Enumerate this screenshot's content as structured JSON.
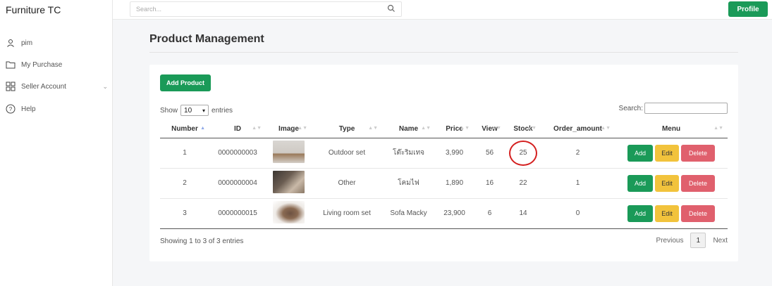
{
  "brand": "Furniture TC",
  "sidebar": {
    "items": [
      {
        "label": "pim",
        "icon": "user-icon"
      },
      {
        "label": "My Purchase",
        "icon": "folder-icon"
      },
      {
        "label": "Seller Account",
        "icon": "grid-icon"
      },
      {
        "label": "Help",
        "icon": "help-icon"
      }
    ]
  },
  "topbar": {
    "search_placeholder": "Search...",
    "profile_label": "Profile"
  },
  "page_title": "Product Management",
  "add_product_label": "Add Product",
  "show": {
    "prefix": "Show",
    "value": "10",
    "suffix": "entries"
  },
  "search_label": "Search:",
  "columns": [
    "Number",
    "ID",
    "Image",
    "Type",
    "Name",
    "Price",
    "View",
    "Stock",
    "Order_amount",
    "Menu"
  ],
  "rows": [
    {
      "number": "1",
      "id": "0000000003",
      "type": "Outdoor set",
      "name": "โต๊ะริมเทจ",
      "price": "3,990",
      "view": "56",
      "stock": "25",
      "order_amount": "2"
    },
    {
      "number": "2",
      "id": "0000000004",
      "type": "Other",
      "name": "โคมไฟ",
      "price": "1,890",
      "view": "16",
      "stock": "22",
      "order_amount": "1"
    },
    {
      "number": "3",
      "id": "0000000015",
      "type": "Living room set",
      "name": "Sofa Macky",
      "price": "23,900",
      "view": "6",
      "stock": "14",
      "order_amount": "0"
    }
  ],
  "row_buttons": {
    "add": "Add",
    "edit": "Edit",
    "delete": "Delete"
  },
  "info_text": "Showing 1 to 3 of 3 entries",
  "pager": {
    "previous": "Previous",
    "page": "1",
    "next": "Next"
  },
  "colors": {
    "green": "#1a9a58",
    "yellow": "#f2c33c",
    "red": "#e0606d",
    "highlight_circle": "#d42020"
  }
}
